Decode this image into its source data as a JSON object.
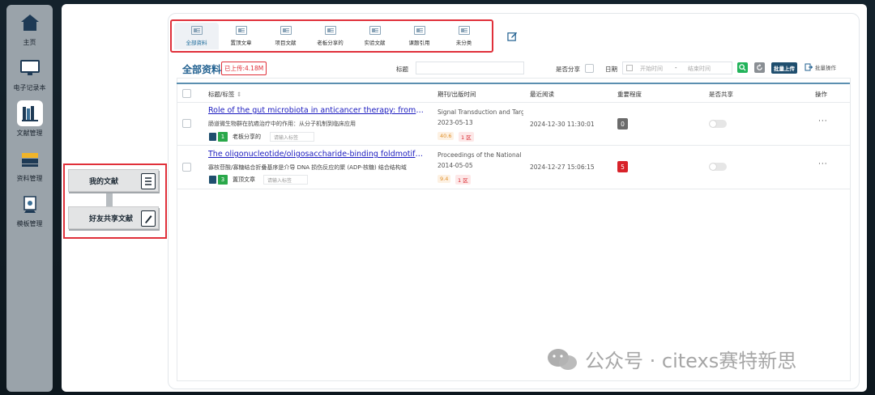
{
  "nav": [
    {
      "label": "主页",
      "icon": "home-icon",
      "active": false
    },
    {
      "label": "电子记录本",
      "icon": "monitor-icon",
      "active": false
    },
    {
      "label": "文献管理",
      "icon": "books-icon",
      "active": true
    },
    {
      "label": "资料管理",
      "icon": "folders-icon",
      "active": false
    },
    {
      "label": "模板管理",
      "icon": "template-icon",
      "active": false
    }
  ],
  "tabs": [
    {
      "label": "全部资料",
      "active": true
    },
    {
      "label": "置顶文章",
      "active": false
    },
    {
      "label": "项目文献",
      "active": false
    },
    {
      "label": "老板分享的",
      "active": false
    },
    {
      "label": "实验文献",
      "active": false
    },
    {
      "label": "课题引用",
      "active": false
    },
    {
      "label": "未分类",
      "active": false
    }
  ],
  "header": {
    "title": "全部资料",
    "upload_badge": "已上传:4.18M",
    "title_filter_label": "标题",
    "share_label": "是否分享",
    "date_label": "日期",
    "start_placeholder": "开始时间",
    "date_sep": "-",
    "end_placeholder": "结束时间",
    "batch_upload": "批量上传",
    "batch_ops": "批量操作"
  },
  "columns": {
    "title": "标题/标签",
    "journal": "期刊/出版时间",
    "last_read": "最近阅读",
    "importance": "重要程度",
    "shared": "是否共享",
    "ops": "操作"
  },
  "rows": [
    {
      "title": "Role of the gut microbiota in anticancer therapy: from molec...",
      "subtitle": "肠道微生物群在抗癌治疗中的作用：从分子机制到临床应用",
      "tag_count": "1",
      "tag": "老板分享的",
      "tag_placeholder": "请输入标签",
      "journal": "Signal Transduction and Targ",
      "date": "2023-05-13",
      "impact": "40.6",
      "zone": "1 区",
      "last_read": "2024-12-30 11:30:01",
      "importance": "0",
      "importance_color": "#6b6b6b",
      "ops": "···"
    },
    {
      "title": "The oligonucleotide/oligosaccharide-binding foldmotif is a p...",
      "subtitle": "寡核苷酸/寡糖结合折叠基序是介导 DNA 损伤反应的聚 (ADP-核糖) 结合结构域",
      "tag_count": "3",
      "tag": "置顶文章",
      "tag_placeholder": "请输入标签",
      "journal": "Proceedings of the National",
      "date": "2014-05-05",
      "impact": "9.4",
      "zone": "1 区",
      "last_read": "2024-12-27 15:06:15",
      "importance": "5",
      "importance_color": "#d8232a",
      "ops": "···"
    }
  ],
  "side_cards": {
    "my_docs": "我的文献",
    "friend_docs": "好友共享文献"
  },
  "watermark": "公众号 · citexs赛特新思",
  "colors": {
    "accent": "#1f5f8f",
    "highlight_red": "#e0303a",
    "green": "#2aa84a"
  }
}
